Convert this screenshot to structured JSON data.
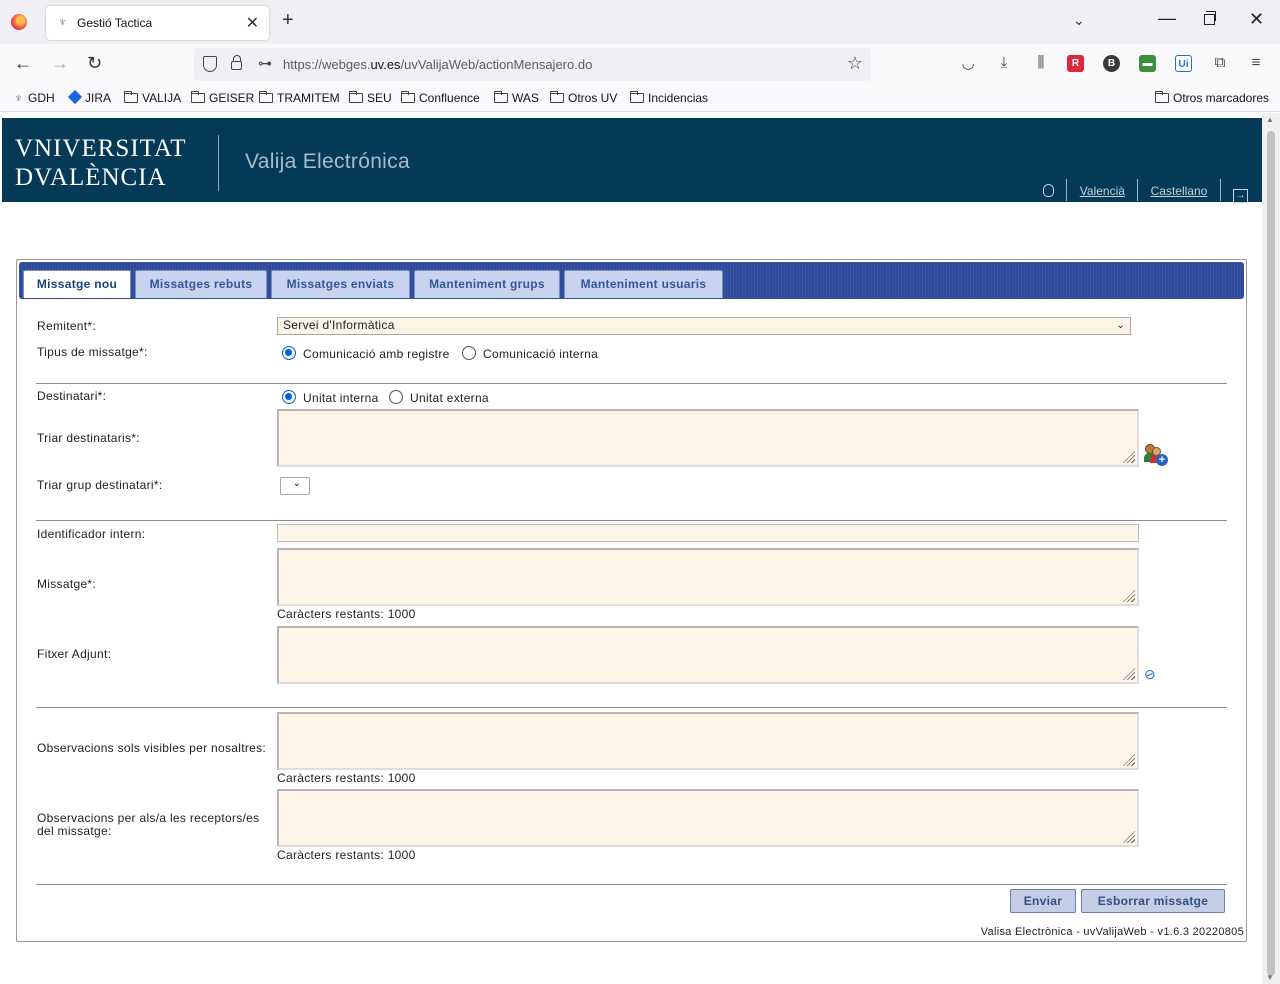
{
  "browser": {
    "tab_title": "Gestió Tactica",
    "url_prefix": "https://webges.",
    "url_domain": "uv.es",
    "url_path": "/uvValijaWeb/actionMensajero.do",
    "bookmarks": [
      "GDH",
      "JIRA",
      "VALIJA",
      "GEISER",
      "TRAMITEM",
      "SEU",
      "Confluence",
      "WAS",
      "Otros UV",
      "Incidencias"
    ],
    "other_bookmarks": "Otros marcadores"
  },
  "header": {
    "logo_line1": "VNIVERSITAT",
    "logo_line2": "DVALÈNCIA",
    "app_title": "Valija Electrónica",
    "lang_valencia": "Valencià",
    "lang_castellano": "Castellano"
  },
  "tabs": [
    "Missatge nou",
    "Missatges rebuts",
    "Missatges enviats",
    "Manteniment grups",
    "Manteniment usuaris"
  ],
  "form": {
    "remitent_label": "Remitent*:",
    "remitent_value": "Servei d'Informàtica",
    "tipus_label": "Tipus de missatge*:",
    "tipus_opt1": "Comunicació amb registre",
    "tipus_opt2": "Comunicació interna",
    "destinatari_label": "Destinatari*:",
    "destinatari_opt1": "Unitat interna",
    "destinatari_opt2": "Unitat externa",
    "triar_dest_label": "Triar destinataris*:",
    "triar_grup_label": "Triar grup destinatari*:",
    "identificador_label": "Identificador intern:",
    "missatge_label": "Missatge*:",
    "counter_missatge": "Caràcters restants: 1000",
    "fitxer_label": "Fitxer Adjunt:",
    "obs_nosaltres_label": "Observacions sols visibles per nosaltres:",
    "counter_obs1": "Caràcters restants: 1000",
    "obs_receptors_label_1": "Observacions per als/a les receptors/es",
    "obs_receptors_label_2": "del missatge:",
    "counter_obs2": "Caràcters restants: 1000"
  },
  "buttons": {
    "enviar": "Enviar",
    "esborrar": "Esborrar missatge"
  },
  "footer": "Valisa Electrònica - uvValijaWeb - v1.6.3 20220805"
}
